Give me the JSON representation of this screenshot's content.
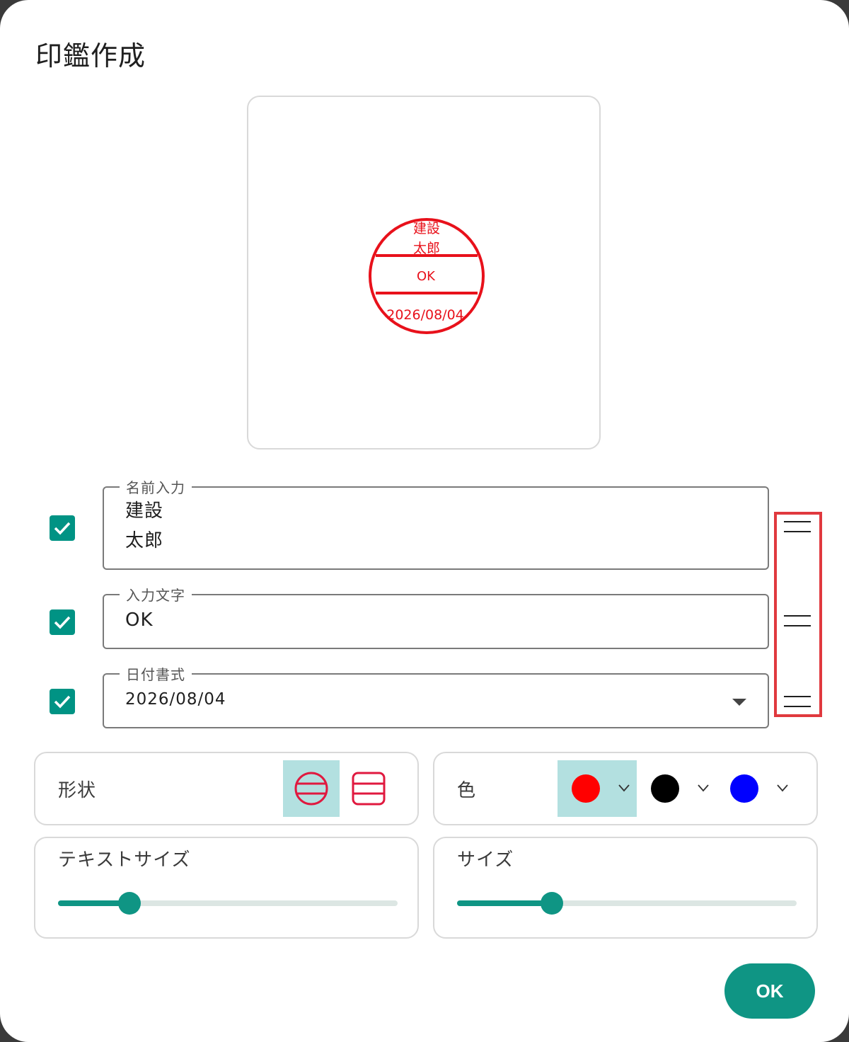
{
  "dialog": {
    "title": "印鑑作成"
  },
  "seal": {
    "name_line1": "建設",
    "name_line2": "太郎",
    "middle_text": "OK",
    "date_text": "2026/08/04",
    "color": "#e8111b"
  },
  "fields": {
    "name": {
      "label": "名前入力",
      "value": "建設\n太郎",
      "checked": true
    },
    "text": {
      "label": "入力文字",
      "value": "OK",
      "checked": true
    },
    "date": {
      "label": "日付書式",
      "value": "2026/08/04",
      "checked": true
    }
  },
  "shape": {
    "label": "形状",
    "selected": "circle"
  },
  "color": {
    "label": "色",
    "options": [
      {
        "name": "red",
        "hex": "#ff0000",
        "selected": true
      },
      {
        "name": "black",
        "hex": "#000000",
        "selected": false
      },
      {
        "name": "blue",
        "hex": "#0000ff",
        "selected": false
      }
    ]
  },
  "text_size": {
    "label": "テキストサイズ",
    "value": 0.21
  },
  "size": {
    "label": "サイズ",
    "value": 0.28
  },
  "ok_button": {
    "label": "OK"
  },
  "accent_color": "#0f9584"
}
